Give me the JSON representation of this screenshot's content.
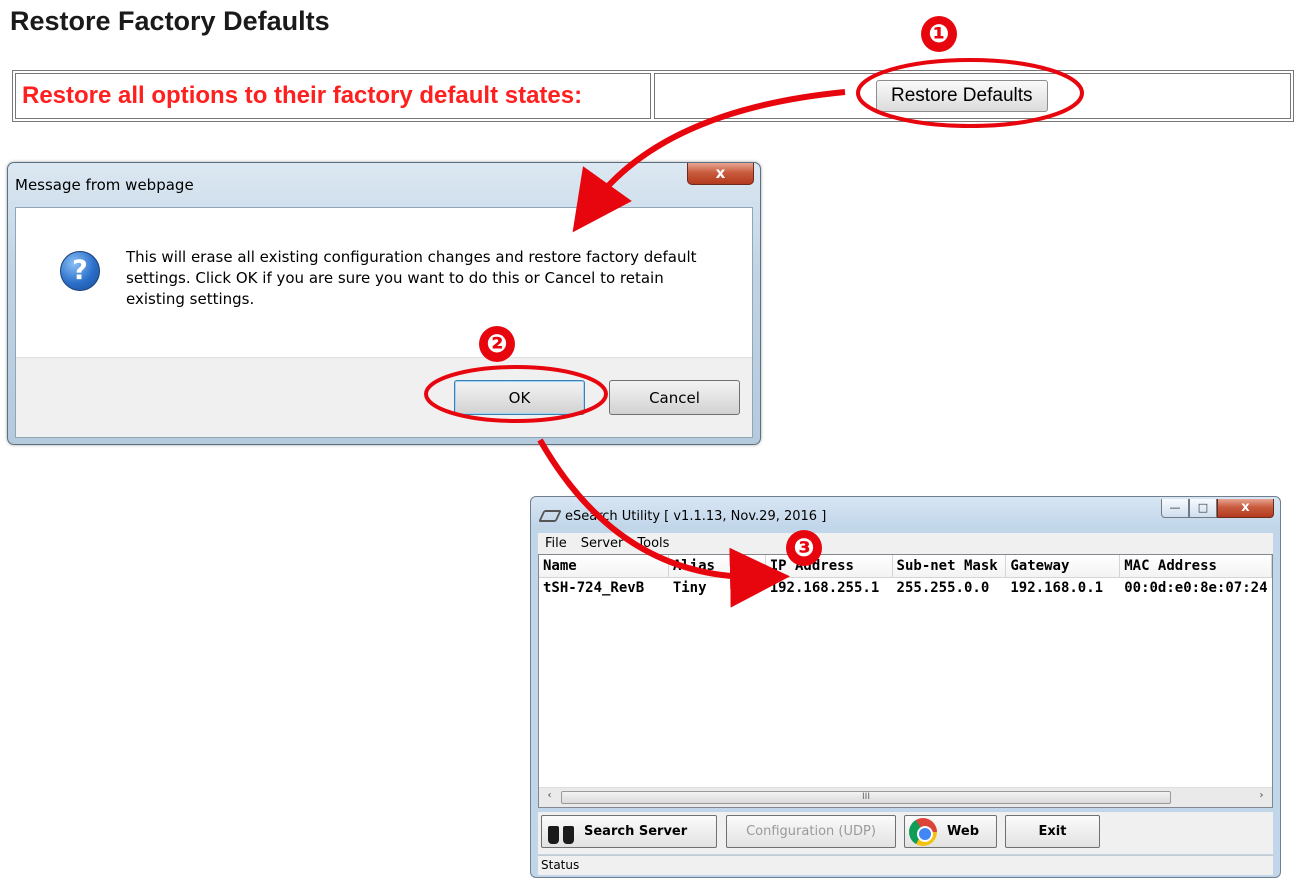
{
  "page": {
    "title": "Restore Factory Defaults",
    "restore_label": "Restore all options to their factory default states:",
    "restore_button": "Restore Defaults"
  },
  "dialog": {
    "title": "Message from webpage",
    "close_glyph": "x",
    "message": "This will erase all existing configuration changes and restore factory default settings. Click OK if you are sure you want to do this or Cancel to retain existing settings.",
    "icon": "question-icon",
    "ok_label": "OK",
    "cancel_label": "Cancel"
  },
  "callouts": [
    "❶",
    "❷",
    "❸"
  ],
  "esearch": {
    "title": "eSearch Utility [ v1.1.13, Nov.29, 2016 ]",
    "menu": [
      "File",
      "Server",
      "Tools"
    ],
    "columns": [
      "Name",
      "Alias",
      "IP Address",
      "Sub-net Mask",
      "Gateway",
      "MAC Address"
    ],
    "rows": [
      [
        "tSH-724_RevB",
        "Tiny",
        "192.168.255.1",
        "255.255.0.0",
        "192.168.0.1",
        "00:0d:e0:8e:07:24"
      ]
    ],
    "scroll_left": "‹",
    "scroll_right": "›",
    "scroll_grip": "III",
    "buttons": {
      "search": "Search Server",
      "config": "Configuration (UDP)",
      "web": "Web",
      "exit": "Exit"
    },
    "status": "Status"
  },
  "colors": {
    "accent_red": "#e8060e",
    "label_red": "#ff1f1f"
  }
}
